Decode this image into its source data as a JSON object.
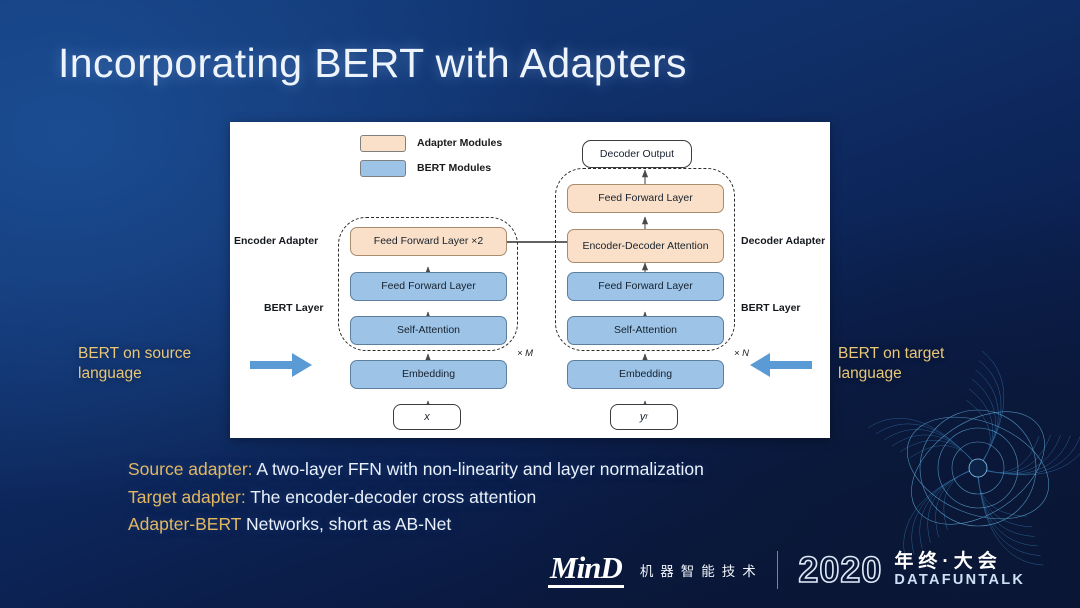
{
  "slide": {
    "title": "Incorporating BERT with Adapters"
  },
  "legend": {
    "items": [
      {
        "label": "Adapter Modules",
        "color": "#fae0c8"
      },
      {
        "label": "BERT Modules",
        "color": "#9dc3e6"
      }
    ]
  },
  "diagram": {
    "encoder": {
      "adapter_label": "Encoder Adapter",
      "bert_label": "BERT Layer",
      "repeat": "× M",
      "nodes": {
        "adapter_ffn": "Feed Forward Layer ×2",
        "ffn": "Feed Forward Layer",
        "attention": "Self-Attention",
        "embedding": "Embedding"
      },
      "input": "x"
    },
    "decoder": {
      "adapter_label": "Decoder Adapter",
      "bert_label": "BERT Layer",
      "repeat": "× N",
      "output": "Decoder Output",
      "nodes": {
        "adapter_ffn": "Feed Forward Layer",
        "cross_attention": "Encoder-Decoder Attention",
        "ffn": "Feed Forward Layer",
        "attention": "Self-Attention",
        "embedding": "Embedding"
      },
      "input_base": "y",
      "input_sup": "r"
    }
  },
  "captions": {
    "left": "BERT on source language",
    "right": "BERT on target language"
  },
  "bullets": [
    {
      "key": "Source adapter:",
      "rest": " A two-layer FFN with non-linearity and layer normalization"
    },
    {
      "key": "Target adapter:",
      "rest": " The encoder-decoder cross attention"
    },
    {
      "key": "Adapter-BERT",
      "rest": " Networks, short as AB-Net"
    }
  ],
  "footer": {
    "logo": "MinD",
    "logo_cn": "机器智能技术",
    "year": "2020",
    "conf_cn": "年终·大会",
    "conf_en": "DATAFUNTALK"
  }
}
